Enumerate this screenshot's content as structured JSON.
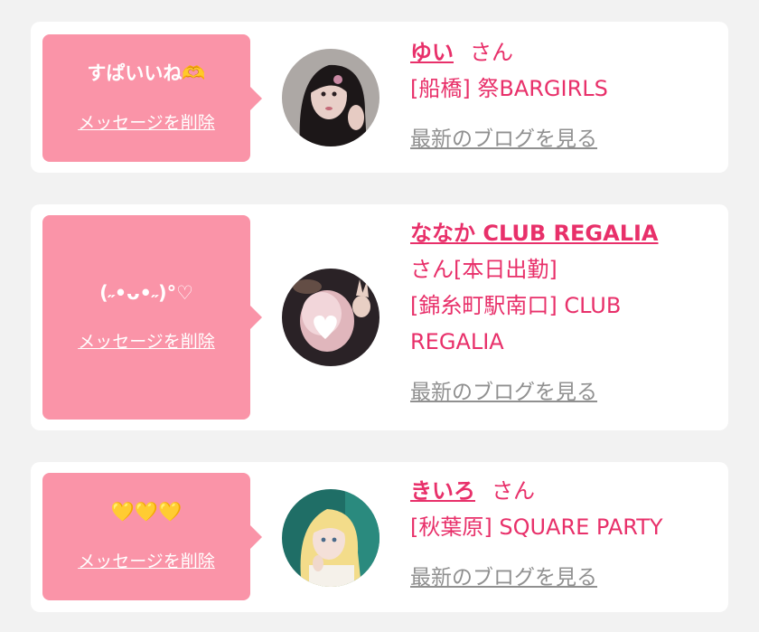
{
  "delete_label": "メッセージを削除",
  "blog_label": "最新のブログを見る",
  "cards": [
    {
      "message": "すぱいいね🫶",
      "name": "ゆい",
      "suffix": "さん",
      "shop": "[船橋] 祭BARGIRLS"
    },
    {
      "message": "(˶•ᴗ•˶)°♡",
      "name": "ななか CLUB REGALIA",
      "suffix": "さん[本日出勤]",
      "shop": "[錦糸町駅南口] CLUB REGALIA"
    },
    {
      "message": "💛💛💛",
      "name": "きいろ",
      "suffix": "さん",
      "shop": "[秋葉原] SQUARE PARTY"
    }
  ],
  "colors": {
    "bubble": "#fa94a8",
    "accent": "#e8306a",
    "link_gray": "#909090",
    "page_bg": "#f2f2f2"
  }
}
